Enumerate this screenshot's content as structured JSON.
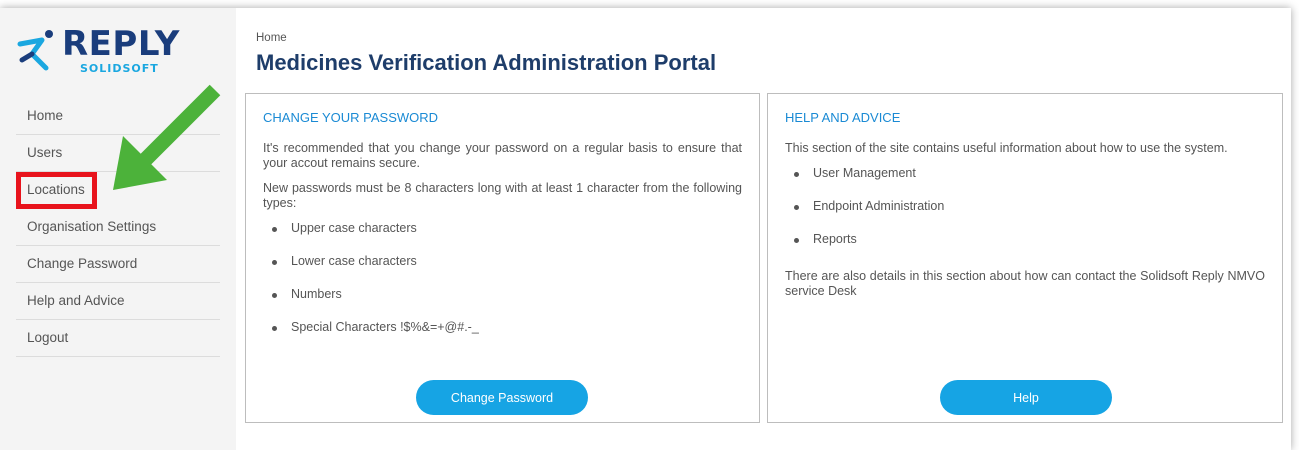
{
  "logo": {
    "word": "REPLY",
    "sub": "SOLIDSOFT"
  },
  "colors": {
    "accent": "#16a4e4",
    "title": "#1e3d6a",
    "highlight": "#e8131c",
    "arrow": "#4cb23a"
  },
  "nav": {
    "items": [
      {
        "label": "Home"
      },
      {
        "label": "Users"
      },
      {
        "label": "Locations"
      },
      {
        "label": "Organisation Settings"
      },
      {
        "label": "Change Password"
      },
      {
        "label": "Help and Advice"
      },
      {
        "label": "Logout"
      }
    ]
  },
  "header": {
    "breadcrumb": "Home",
    "title": "Medicines Verification Administration Portal"
  },
  "password_panel": {
    "heading": "CHANGE YOUR PASSWORD",
    "para1": "It's recommended that you change your password on a regular basis to ensure that your accout remains secure.",
    "para2": "New passwords must be 8 characters long with at least 1 character from the following types:",
    "items": [
      "Upper case characters",
      "Lower case characters",
      "Numbers",
      "Special Characters !$%&=+@#.-_"
    ],
    "button": "Change Password"
  },
  "help_panel": {
    "heading": "HELP AND ADVICE",
    "para1": "This section of the site contains useful information about how to use the system.",
    "items": [
      "User Management",
      "Endpoint Administration",
      "Reports"
    ],
    "para2": "There are also details in this section about how can contact the Solidsoft Reply NMVO service Desk",
    "button": "Help"
  }
}
